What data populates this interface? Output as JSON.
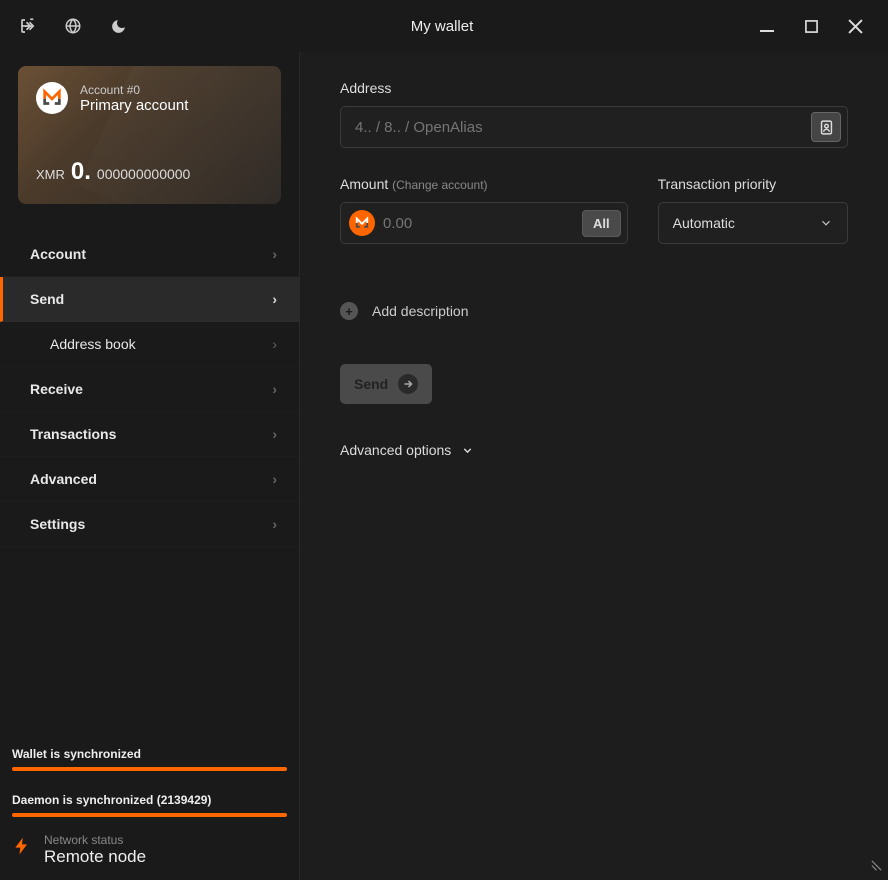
{
  "window": {
    "title": "My wallet"
  },
  "account_card": {
    "subtitle": "Account #0",
    "title": "Primary account",
    "currency": "XMR",
    "balance_int": "0.",
    "balance_dec": "000000000000"
  },
  "nav": {
    "account": "Account",
    "send": "Send",
    "address_book": "Address book",
    "receive": "Receive",
    "transactions": "Transactions",
    "advanced": "Advanced",
    "settings": "Settings"
  },
  "sync": {
    "wallet": "Wallet is synchronized",
    "daemon": "Daemon is synchronized (2139429)"
  },
  "network_status": {
    "label": "Network status",
    "value": "Remote node"
  },
  "form": {
    "address_label": "Address",
    "address_placeholder": "4.. / 8.. / OpenAlias",
    "amount_label": "Amount",
    "amount_hint": "(Change account)",
    "amount_placeholder": "0.00",
    "all_btn": "All",
    "priority_label": "Transaction priority",
    "priority_value": "Automatic",
    "add_description": "Add description",
    "send_btn": "Send",
    "advanced_options": "Advanced options"
  }
}
